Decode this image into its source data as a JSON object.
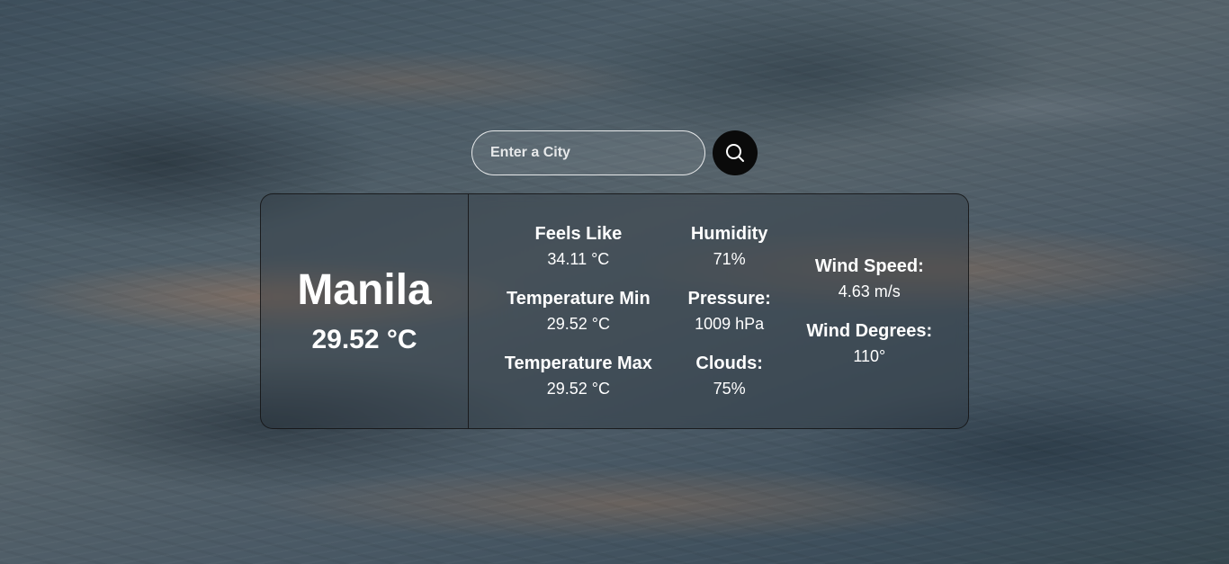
{
  "search": {
    "placeholder": "Enter a City",
    "button_icon": "search-icon"
  },
  "weather": {
    "city": "Manila",
    "temperature": "29.52 °C",
    "column1": [
      {
        "label": "Feels Like",
        "value": "34.11 °C"
      },
      {
        "label": "Temperature Min",
        "value": "29.52 °C"
      },
      {
        "label": "Temperature Max",
        "value": "29.52 °C"
      }
    ],
    "column2": [
      {
        "label": "Humidity",
        "value": "71%"
      },
      {
        "label": "Pressure:",
        "value": "1009 hPa"
      },
      {
        "label": "Clouds:",
        "value": "75%"
      }
    ],
    "column3": [
      {
        "label": "Wind Speed:",
        "value": "4.63 m/s"
      },
      {
        "label": "Wind Degrees:",
        "value": "110°"
      }
    ]
  },
  "colors": {
    "text": "#ffffff",
    "button_bg": "#0a0a0a"
  }
}
